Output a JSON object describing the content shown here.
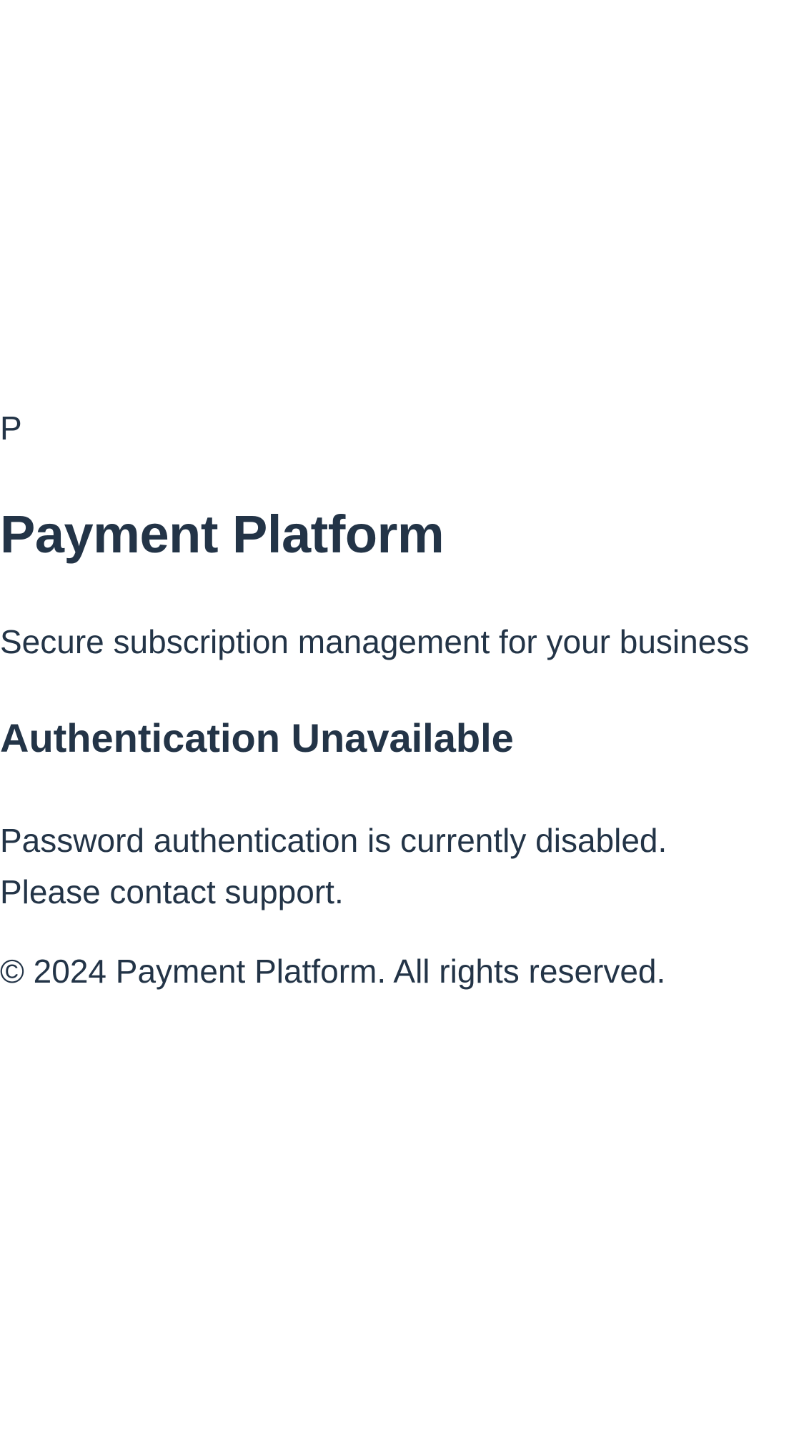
{
  "brand": {
    "logo_letter": "P",
    "title": "Payment Platform",
    "tagline": "Secure subscription management for your business"
  },
  "auth": {
    "heading": "Authentication Unavailable",
    "message_line_1": "Password authentication is currently disabled.",
    "message_line_2": "Please contact support."
  },
  "footer": {
    "copyright": "© 2024 Payment Platform. All rights reserved."
  },
  "colors": {
    "text": "#233447",
    "background": "#ffffff"
  }
}
